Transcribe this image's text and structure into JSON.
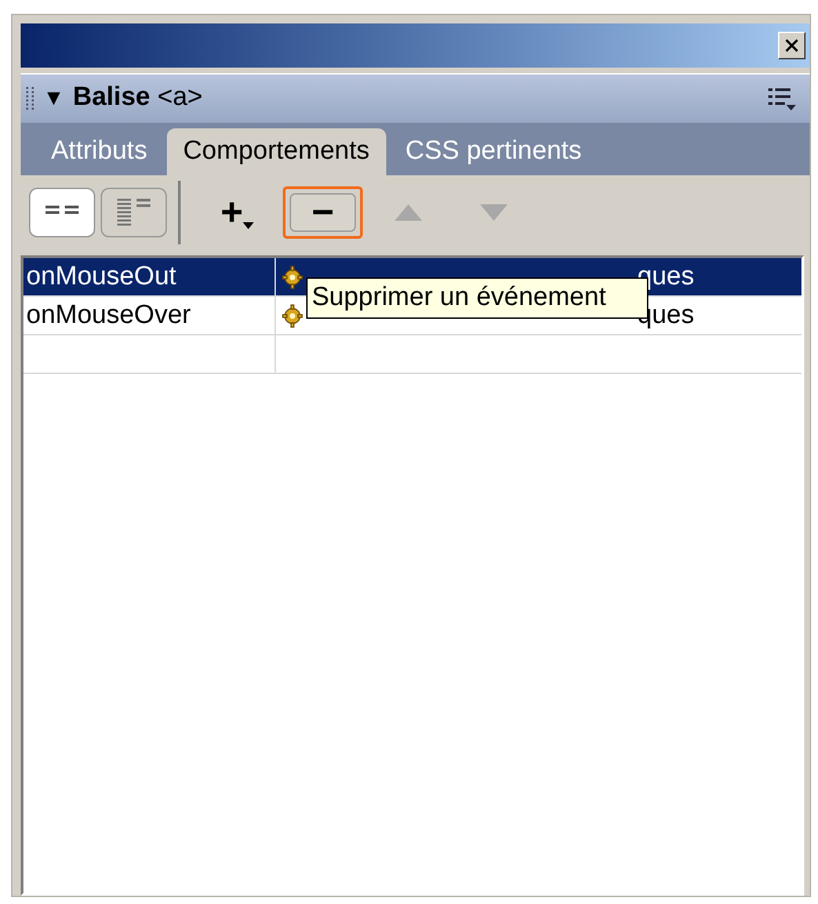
{
  "panel": {
    "title": "**Balise** <a>",
    "collapse_glyph": "▼"
  },
  "tabs": [
    {
      "label": "Attributs",
      "selected": false
    },
    {
      "label": "Comportements",
      "selected": true
    },
    {
      "label": "CSS pertinents",
      "selected": false
    }
  ],
  "toolbar": {
    "views": [
      {
        "kind": "list",
        "selected": true
      },
      {
        "kind": "all",
        "selected": false
      }
    ],
    "buttons": [
      {
        "kind": "add",
        "glyph": "+",
        "hovered": false
      },
      {
        "kind": "remove",
        "glyph": "−",
        "hovered": true
      },
      {
        "kind": "up",
        "hovered": false,
        "disabled": true
      },
      {
        "kind": "down",
        "hovered": false,
        "disabled": true
      }
    ]
  },
  "events": [
    {
      "event": "onMouseOut",
      "action": "ques",
      "selected": true
    },
    {
      "event": "onMouseOver",
      "action": "ques",
      "selected": false
    }
  ],
  "tooltip": "Supprimer un événement"
}
